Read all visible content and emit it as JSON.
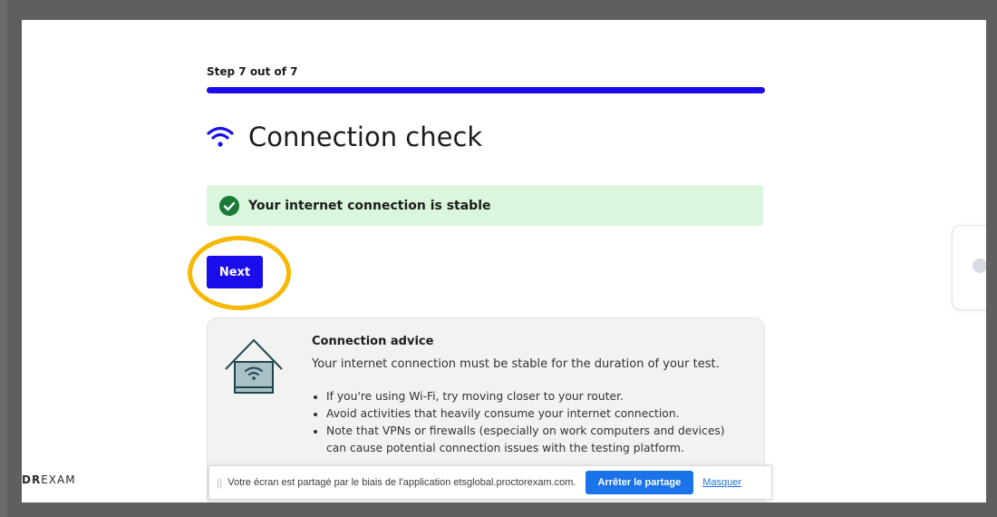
{
  "step": {
    "label": "Step 7 out of 7",
    "progress_fraction": 1.0
  },
  "page": {
    "title": "Connection check",
    "title_icon": "wifi-icon"
  },
  "status": {
    "message": "Your internet connection is stable",
    "icon": "check-circle-icon",
    "background": "#daf6dc"
  },
  "actions": {
    "next_label": "Next"
  },
  "advice": {
    "title": "Connection advice",
    "intro": "Your internet connection must be stable for the duration of your test.",
    "tips": [
      "If you're using Wi-Fi, try moving closer to your router.",
      "Avoid activities that heavily consume your internet connection.",
      "Note that VPNs or firewalls (especially on work computers and devices) can cause potential connection issues with the testing platform."
    ],
    "icon": "house-wifi-icon"
  },
  "brand": {
    "bold": "DR",
    "rest": "EXAM"
  },
  "screen_share": {
    "grip": "||",
    "message": "Votre écran est partagé par le biais de l'application etsglobal.proctorexam.com.",
    "stop_label": "Arrêter le partage",
    "hide_label": "Masquer"
  },
  "colors": {
    "accent": "#1a0dea",
    "highlight": "#f6b800",
    "share_button": "#1a73e8"
  }
}
